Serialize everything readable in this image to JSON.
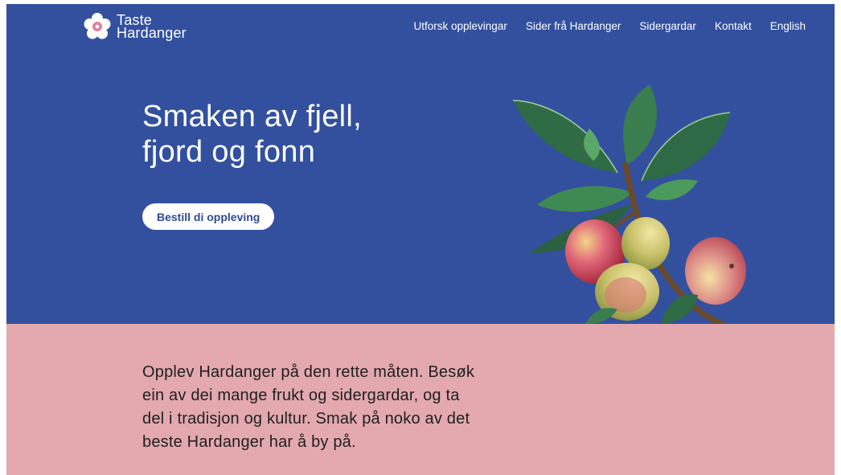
{
  "brand": {
    "name_line1": "Taste",
    "name_line2": "Hardanger",
    "logo_icon": "flower-icon"
  },
  "nav": {
    "items": [
      {
        "label": "Utforsk opplevingar"
      },
      {
        "label": "Sider frå Hardanger"
      },
      {
        "label": "Sidergardar"
      },
      {
        "label": "Kontakt"
      },
      {
        "label": "English"
      }
    ]
  },
  "hero": {
    "headline_line1": "Smaken av fjell,",
    "headline_line2": "fjord og fonn",
    "cta_label": "Bestill di oppleving",
    "illustration": "apple-branch-illustration"
  },
  "intro": {
    "text": "Opplev Hardanger på den rette måten. Besøk ein av dei mange frukt og sidergardar, og ta del i tradisjon og kultur. Smak på noko av det beste Hardanger har å by på."
  },
  "colors": {
    "hero_background": "#33509f",
    "intro_background": "#e3a9ae",
    "cta_text": "#2f4b96"
  }
}
